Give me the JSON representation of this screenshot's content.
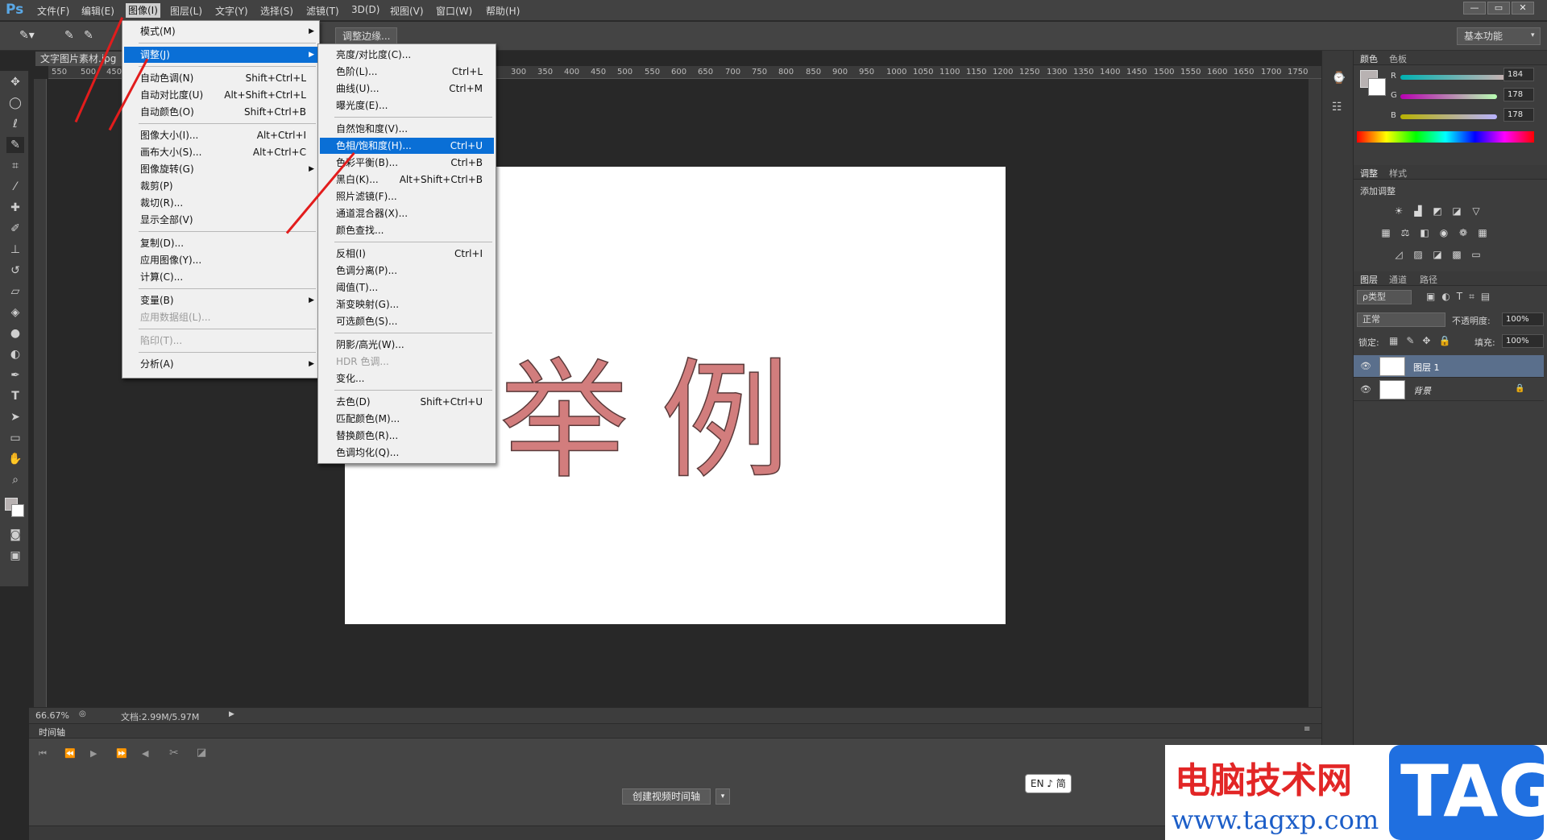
{
  "menubar": {
    "logo": "Ps",
    "items": [
      "文件(F)",
      "编辑(E)",
      "图像(I)",
      "图层(L)",
      "文字(Y)",
      "选择(S)",
      "滤镜(T)",
      "3D(D)",
      "视图(V)",
      "窗口(W)",
      "帮助(H)"
    ],
    "active_index": 2
  },
  "window_controls": [
    "—",
    "▭",
    "✕"
  ],
  "options": {
    "refine_edge": "调整边缘...",
    "workspace": "基本功能"
  },
  "document": {
    "tab_title": "文字图片素材.jpg",
    "sample_text": "举例",
    "zoom": "66.67%",
    "doc_info": "文档:2.99M/5.97M"
  },
  "ruler_ticks": [
    "550",
    "500",
    "450",
    "300",
    "350",
    "400",
    "450",
    "500",
    "550",
    "600",
    "650",
    "700",
    "750",
    "800",
    "850",
    "900",
    "950",
    "1000",
    "1050",
    "1100",
    "1150",
    "1200",
    "1250",
    "1300",
    "1350",
    "1400",
    "1450",
    "1500",
    "1550",
    "1600",
    "1650",
    "1700",
    "1750"
  ],
  "image_menu": [
    {
      "label": "模式(M)",
      "submenu": true
    },
    {
      "sep": true
    },
    {
      "label": "调整(J)",
      "submenu": true,
      "highlight": true
    },
    {
      "sep": true
    },
    {
      "label": "自动色调(N)",
      "shortcut": "Shift+Ctrl+L"
    },
    {
      "label": "自动对比度(U)",
      "shortcut": "Alt+Shift+Ctrl+L"
    },
    {
      "label": "自动颜色(O)",
      "shortcut": "Shift+Ctrl+B"
    },
    {
      "sep": true
    },
    {
      "label": "图像大小(I)...",
      "shortcut": "Alt+Ctrl+I"
    },
    {
      "label": "画布大小(S)...",
      "shortcut": "Alt+Ctrl+C"
    },
    {
      "label": "图像旋转(G)",
      "submenu": true
    },
    {
      "label": "裁剪(P)"
    },
    {
      "label": "裁切(R)..."
    },
    {
      "label": "显示全部(V)"
    },
    {
      "sep": true
    },
    {
      "label": "复制(D)..."
    },
    {
      "label": "应用图像(Y)..."
    },
    {
      "label": "计算(C)..."
    },
    {
      "sep": true
    },
    {
      "label": "变量(B)",
      "submenu": true
    },
    {
      "label": "应用数据组(L)...",
      "disabled": true
    },
    {
      "sep": true
    },
    {
      "label": "陷印(T)...",
      "disabled": true
    },
    {
      "sep": true
    },
    {
      "label": "分析(A)",
      "submenu": true
    }
  ],
  "adjust_menu": [
    {
      "label": "亮度/对比度(C)..."
    },
    {
      "label": "色阶(L)...",
      "shortcut": "Ctrl+L"
    },
    {
      "label": "曲线(U)...",
      "shortcut": "Ctrl+M"
    },
    {
      "label": "曝光度(E)..."
    },
    {
      "sep": true
    },
    {
      "label": "自然饱和度(V)..."
    },
    {
      "label": "色相/饱和度(H)...",
      "shortcut": "Ctrl+U",
      "highlight": true
    },
    {
      "label": "色彩平衡(B)...",
      "shortcut": "Ctrl+B"
    },
    {
      "label": "黑白(K)...",
      "shortcut": "Alt+Shift+Ctrl+B"
    },
    {
      "label": "照片滤镜(F)..."
    },
    {
      "label": "通道混合器(X)..."
    },
    {
      "label": "颜色查找..."
    },
    {
      "sep": true
    },
    {
      "label": "反相(I)",
      "shortcut": "Ctrl+I"
    },
    {
      "label": "色调分离(P)..."
    },
    {
      "label": "阈值(T)..."
    },
    {
      "label": "渐变映射(G)..."
    },
    {
      "label": "可选颜色(S)..."
    },
    {
      "sep": true
    },
    {
      "label": "阴影/高光(W)..."
    },
    {
      "label": "HDR 色调...",
      "disabled": true
    },
    {
      "label": "变化..."
    },
    {
      "sep": true
    },
    {
      "label": "去色(D)",
      "shortcut": "Shift+Ctrl+U"
    },
    {
      "label": "匹配颜色(M)..."
    },
    {
      "label": "替换颜色(R)..."
    },
    {
      "label": "色调均化(Q)..."
    }
  ],
  "color_panel": {
    "tabs": [
      "颜色",
      "色板"
    ],
    "channels": [
      {
        "name": "R",
        "value": "184"
      },
      {
        "name": "G",
        "value": "178"
      },
      {
        "name": "B",
        "value": "178"
      }
    ]
  },
  "adjust_panel": {
    "tabs": [
      "调整",
      "样式"
    ],
    "title": "添加调整"
  },
  "layers_panel": {
    "tabs": [
      "图层",
      "通道",
      "路径"
    ],
    "filter_kind": "ρ类型",
    "blend_mode": "正常",
    "opacity_label": "不透明度:",
    "opacity": "100%",
    "lock_label": "锁定:",
    "fill_label": "填充:",
    "fill": "100%",
    "layers": [
      {
        "name": "图层 1",
        "selected": true
      },
      {
        "name": "背景",
        "locked": true
      }
    ]
  },
  "timeline": {
    "title": "时间轴",
    "create_button": "创建视频时间轴"
  },
  "ime_indicator": "EN ♪ 简",
  "watermark": {
    "title": "电脑技术网",
    "url": "www.tagxp.com",
    "tag": "TAG"
  },
  "colors": {
    "accent": "#0a6fd6",
    "annotation_arrow": "#e21c1c",
    "sample_text": "#d27d7d"
  }
}
